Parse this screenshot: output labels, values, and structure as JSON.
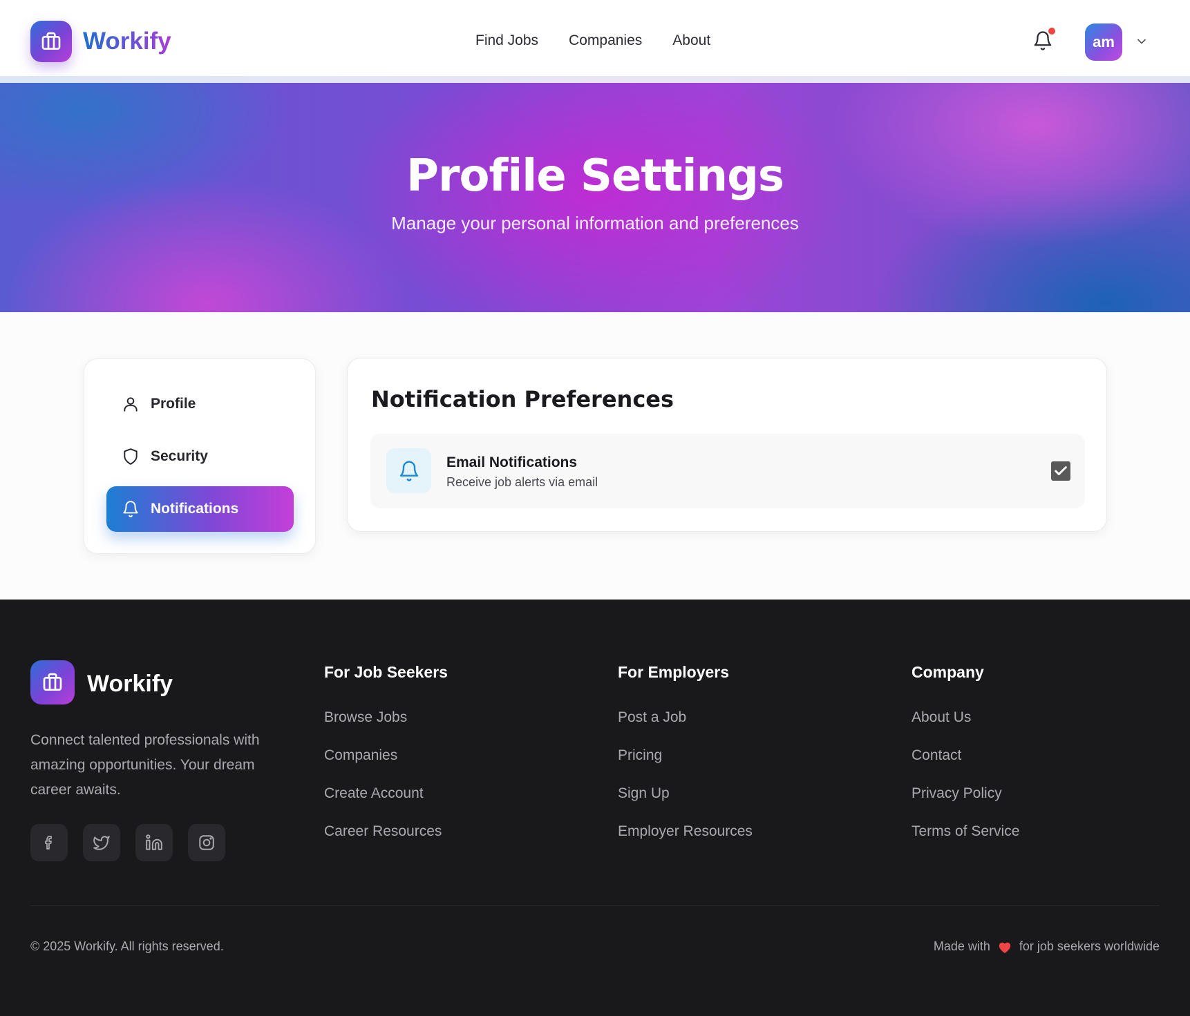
{
  "brand": {
    "name": "Workify"
  },
  "nav": {
    "links": [
      "Find Jobs",
      "Companies",
      "About"
    ],
    "avatar_initials": "am"
  },
  "hero": {
    "title": "Profile Settings",
    "subtitle": "Manage your personal information and preferences"
  },
  "sidebar": {
    "items": [
      {
        "label": "Profile",
        "icon": "user-icon",
        "active": false
      },
      {
        "label": "Security",
        "icon": "shield-icon",
        "active": false
      },
      {
        "label": "Notifications",
        "icon": "bell-icon",
        "active": true
      }
    ]
  },
  "main": {
    "title": "Notification Preferences",
    "preferences": [
      {
        "title": "Email Notifications",
        "description": "Receive job alerts via email",
        "checked": true,
        "icon": "bell-icon"
      }
    ]
  },
  "footer": {
    "brand": "Workify",
    "description": "Connect talented professionals with amazing opportunities. Your dream career awaits.",
    "social": [
      "facebook-icon",
      "twitter-icon",
      "linkedin-icon",
      "instagram-icon"
    ],
    "columns": [
      {
        "heading": "For Job Seekers",
        "links": [
          "Browse Jobs",
          "Companies",
          "Create Account",
          "Career Resources"
        ]
      },
      {
        "heading": "For Employers",
        "links": [
          "Post a Job",
          "Pricing",
          "Sign Up",
          "Employer Resources"
        ]
      },
      {
        "heading": "Company",
        "links": [
          "About Us",
          "Contact",
          "Privacy Policy",
          "Terms of Service"
        ]
      }
    ],
    "copyright": "© 2025 Workify. All rights reserved.",
    "made_with_prefix": "Made with",
    "made_with_suffix": "for job seekers worldwide"
  },
  "colors": {
    "accent_start": "#1c7fd2",
    "accent_end": "#c43fd9",
    "notification_dot": "#ef4444",
    "heart": "#ef4444",
    "footer_bg": "#19191c"
  }
}
